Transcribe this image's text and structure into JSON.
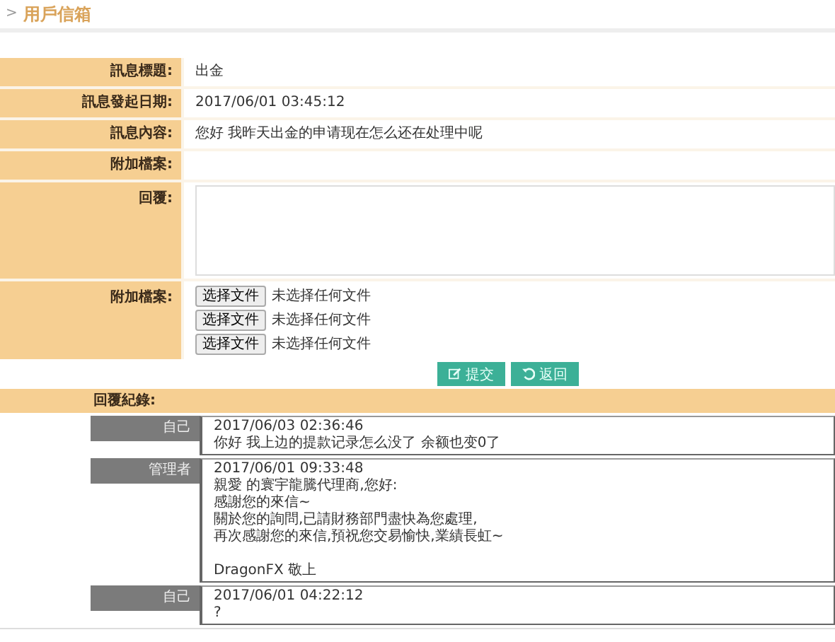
{
  "breadcrumb": {
    "marker": ">",
    "title": "用戶信箱"
  },
  "fields": [
    {
      "kind": "text",
      "label": "訊息標題:",
      "value": "出金"
    },
    {
      "kind": "text",
      "label": "訊息發起日期:",
      "value": "2017/06/01 03:45:12"
    },
    {
      "kind": "text",
      "label": "訊息內容:",
      "value": "您好 我昨天出金的申请现在怎么还在处理中呢"
    },
    {
      "kind": "empty",
      "label": "附加檔案:"
    },
    {
      "kind": "textarea",
      "label": "回覆:"
    },
    {
      "kind": "files",
      "label": "附加檔案:",
      "files": [
        {
          "button": "选择文件",
          "status": "未选择任何文件"
        },
        {
          "button": "选择文件",
          "status": "未选择任何文件"
        },
        {
          "button": "选择文件",
          "status": "未选择任何文件"
        }
      ]
    }
  ],
  "buttons": [
    {
      "kind": "submit",
      "label": "提交"
    },
    {
      "kind": "back",
      "label": "返回"
    }
  ],
  "history": {
    "title": "回覆紀錄:",
    "records": [
      {
        "sender": "自己",
        "time": "2017/06/03 02:36:46",
        "lines": [
          "你好 我上边的提款记录怎么没了 余额也变0了"
        ]
      },
      {
        "sender": "管理者",
        "time": "2017/06/01 09:33:48",
        "lines": [
          "親愛 的寰宇龍騰代理商,您好:",
          "感謝您的來信~",
          "關於您的詢問,已請財務部門盡快為您處理,",
          "再次感謝您的來信,預祝您交易愉快,業績長虹~"
        ],
        "signature": "DragonFX 敬上"
      },
      {
        "sender": "自己",
        "time": "2017/06/01 04:22:12",
        "lines": [
          "?"
        ]
      }
    ]
  }
}
